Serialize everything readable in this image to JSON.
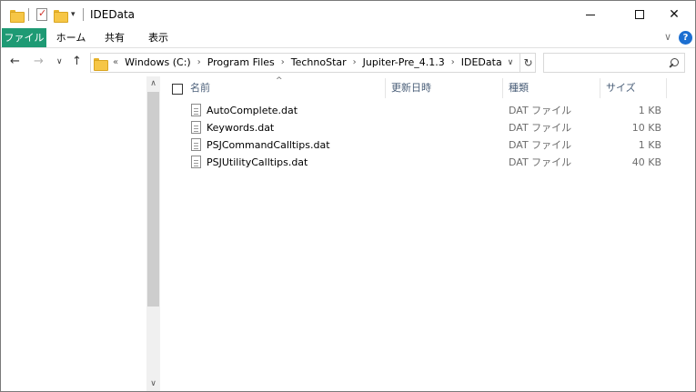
{
  "window": {
    "title": "IDEData",
    "quick_access_dropdown": "▾",
    "controls": {
      "minimize": "—",
      "maximize": "☐",
      "close": "✕"
    }
  },
  "ribbon": {
    "tabs": [
      {
        "label": "ファイル",
        "active": true
      },
      {
        "label": "ホーム"
      },
      {
        "label": "共有"
      },
      {
        "label": "表示"
      }
    ],
    "expand_chevron": "∨",
    "help": "?"
  },
  "navigation": {
    "back": "←",
    "forward": "→",
    "recent_dropdown": "∨",
    "up": "↑",
    "breadcrumb_overflow": "«",
    "breadcrumb_separator": "›",
    "breadcrumb": [
      "Windows (C:)",
      "Program Files",
      "TechnoStar",
      "Jupiter-Pre_4.1.3",
      "IDEData"
    ],
    "address_dropdown": "∨",
    "refresh": "↻",
    "search_placeholder": ""
  },
  "file_list": {
    "sort_indicator": "^",
    "columns": {
      "name": "名前",
      "modified": "更新日時",
      "type": "種類",
      "size": "サイズ"
    },
    "rows": [
      {
        "name": "AutoComplete.dat",
        "modified": "",
        "type": "DAT ファイル",
        "size": "1 KB"
      },
      {
        "name": "Keywords.dat",
        "modified": "",
        "type": "DAT ファイル",
        "size": "10 KB"
      },
      {
        "name": "PSJCommandCalltips.dat",
        "modified": "",
        "type": "DAT ファイル",
        "size": "1 KB"
      },
      {
        "name": "PSJUtilityCalltips.dat",
        "modified": "",
        "type": "DAT ファイル",
        "size": "40 KB"
      }
    ]
  },
  "scrollbar": {
    "up": "∧",
    "down": "∨"
  },
  "colors": {
    "file_tab": "#1e9a74",
    "help": "#1c6fd1",
    "folder": "#f6c646",
    "header_text": "#4c607a"
  }
}
